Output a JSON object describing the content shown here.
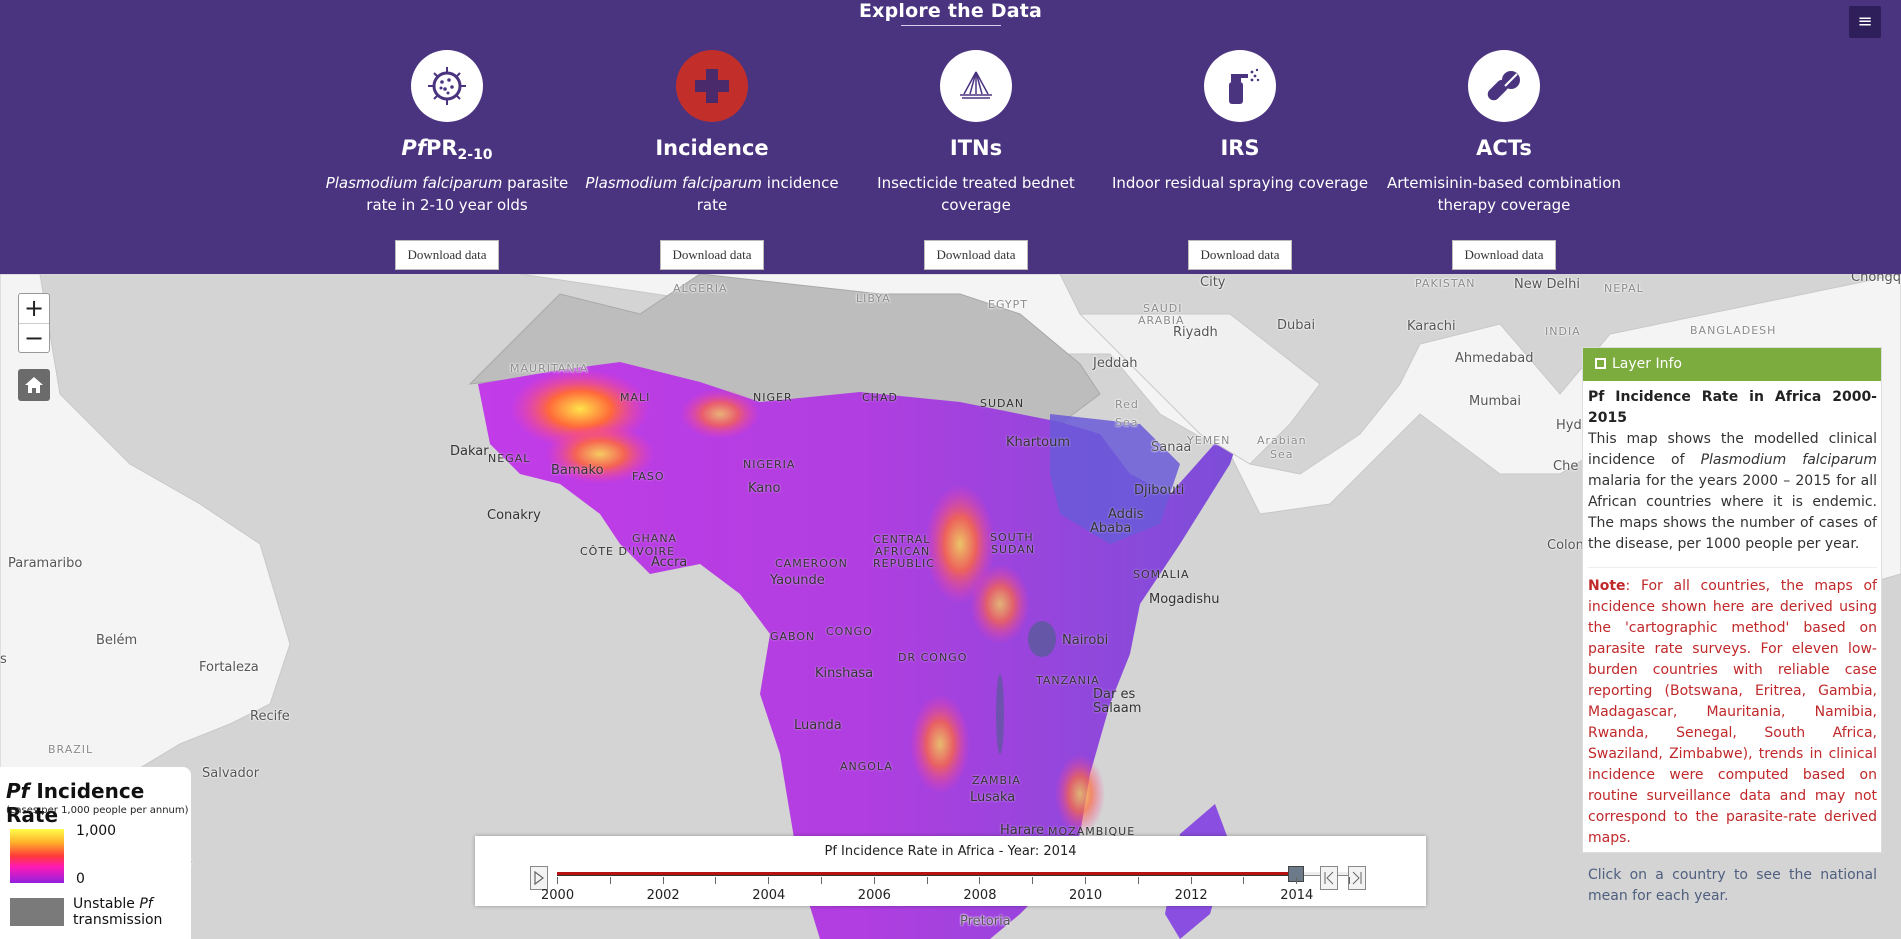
{
  "header": {
    "title": "Explore the Data",
    "menu_icon": "≡",
    "cards": [
      {
        "title_it": "Pf",
        "title": "PR",
        "title_sub": "2-10",
        "desc_it": "Plasmodium falciparum",
        "desc": " parasite rate in 2-10 year olds",
        "button": "Download data",
        "icon": "parasite-icon"
      },
      {
        "title_it": "",
        "title": "Incidence",
        "title_sub": "",
        "desc_it": "Plasmodium falciparum",
        "desc": " incidence rate",
        "button": "Download data",
        "icon": "medical-cross-icon"
      },
      {
        "title_it": "",
        "title": "ITNs",
        "title_sub": "",
        "desc_it": "",
        "desc": "Insecticide treated bednet coverage",
        "button": "Download data",
        "icon": "bednet-icon"
      },
      {
        "title_it": "",
        "title": "IRS",
        "title_sub": "",
        "desc_it": "",
        "desc": "Indoor residual spraying coverage",
        "button": "Download data",
        "icon": "spray-bottle-icon"
      },
      {
        "title_it": "",
        "title": "ACTs",
        "title_sub": "",
        "desc_it": "",
        "desc": "Artemisinin-based combination therapy coverage",
        "button": "Download data",
        "icon": "pills-icon"
      }
    ]
  },
  "map": {
    "zoom_in": "+",
    "zoom_out": "−",
    "places": [
      {
        "id": "algeria",
        "text": "ALGERIA"
      },
      {
        "id": "libya",
        "text": "LIBYA"
      },
      {
        "id": "egypt",
        "text": "EGYPT"
      },
      {
        "id": "city",
        "text": "City"
      },
      {
        "id": "saudi",
        "text": "SAUDI"
      },
      {
        "id": "arabia",
        "text": "ARABIA"
      },
      {
        "id": "riyadh",
        "text": "Riyadh"
      },
      {
        "id": "dubai",
        "text": "Dubai"
      },
      {
        "id": "pakistan",
        "text": "PAKISTAN"
      },
      {
        "id": "newdelhi",
        "text": "New Delhi"
      },
      {
        "id": "nepal",
        "text": "NEPAL"
      },
      {
        "id": "chongqing",
        "text": "Chongqir"
      },
      {
        "id": "karachi",
        "text": "Karachi"
      },
      {
        "id": "india",
        "text": "INDIA"
      },
      {
        "id": "bangladesh",
        "text": "BANGLADESH"
      },
      {
        "id": "ahmedabad",
        "text": "Ahmedabad"
      },
      {
        "id": "jeddah",
        "text": "Jeddah"
      },
      {
        "id": "mauritania",
        "text": "MAURITANIA"
      },
      {
        "id": "mumbai",
        "text": "Mumbai"
      },
      {
        "id": "hyderabad",
        "text": "Hyderaba"
      },
      {
        "id": "dakar",
        "text": "Dakar"
      },
      {
        "id": "bamako",
        "text": "Bamako"
      },
      {
        "id": "khartoum",
        "text": "Khartoum"
      },
      {
        "id": "sanaa",
        "text": "Sanaa"
      },
      {
        "id": "yemen",
        "text": "YEMEN"
      },
      {
        "id": "arabiansea",
        "text": "Arabian"
      },
      {
        "id": "sea",
        "text": "Sea"
      },
      {
        "id": "kano",
        "text": "Kano"
      },
      {
        "id": "djibouti",
        "text": "Djibouti"
      },
      {
        "id": "conakry",
        "text": "Conakry"
      },
      {
        "id": "addis",
        "text": "Addis"
      },
      {
        "id": "ababa",
        "text": "Ababa"
      },
      {
        "id": "southsudan",
        "text": "SOUTH"
      },
      {
        "id": "sudan2",
        "text": "SUDAN"
      },
      {
        "id": "car",
        "text": "CENTRAL"
      },
      {
        "id": "car2",
        "text": "AFRICAN"
      },
      {
        "id": "car3",
        "text": "REPUBLIC"
      },
      {
        "id": "cameroon",
        "text": "CAMEROON"
      },
      {
        "id": "paramaribo",
        "text": "Paramaribo"
      },
      {
        "id": "accra",
        "text": "Accra"
      },
      {
        "id": "colombo",
        "text": "Colon"
      },
      {
        "id": "somalia",
        "text": "SOMALIA"
      },
      {
        "id": "yaounde",
        "text": "Yaounde"
      },
      {
        "id": "mogadishu",
        "text": "Mogadishu"
      },
      {
        "id": "belem",
        "text": "Belém"
      },
      {
        "id": "gabon",
        "text": "GABON"
      },
      {
        "id": "congo",
        "text": "CONGO"
      },
      {
        "id": "nairobi",
        "text": "Nairobi"
      },
      {
        "id": "fortaleza",
        "text": "Fortaleza"
      },
      {
        "id": "drcongo",
        "text": "DR CONGO"
      },
      {
        "id": "kinshasa",
        "text": "Kinshasa"
      },
      {
        "id": "tanzania",
        "text": "TANZANIA"
      },
      {
        "id": "dar",
        "text": "Dar es"
      },
      {
        "id": "salaam",
        "text": "Salaam"
      },
      {
        "id": "recife",
        "text": "Recife"
      },
      {
        "id": "luanda",
        "text": "Luanda"
      },
      {
        "id": "brazil",
        "text": "BRAZIL"
      },
      {
        "id": "angola",
        "text": "ANGOLA"
      },
      {
        "id": "salvador",
        "text": "Salvador"
      },
      {
        "id": "zambia",
        "text": "ZAMBIA"
      },
      {
        "id": "lusaka",
        "text": "Lusaka"
      },
      {
        "id": "harare",
        "text": "Harare"
      },
      {
        "id": "mozambique",
        "text": "MOZAMBIQUE"
      },
      {
        "id": "pretoria",
        "text": "Pretoria"
      },
      {
        "id": "s",
        "text": "s"
      },
      {
        "id": "e",
        "text": "e"
      },
      {
        "id": "che",
        "text": "Che"
      },
      {
        "id": "mali",
        "text": "MALI"
      },
      {
        "id": "niger",
        "text": "NIGER"
      },
      {
        "id": "chad",
        "text": "CHAD"
      },
      {
        "id": "sudan",
        "text": "SUDAN"
      },
      {
        "id": "nigeria",
        "text": "NIGERIA"
      },
      {
        "id": "ghana",
        "text": "GHANA"
      },
      {
        "id": "cotedivoire",
        "text": "CÔTE D'IVOIRE"
      },
      {
        "id": "burkina",
        "text": "FASO"
      },
      {
        "id": "red",
        "text": "Red"
      },
      {
        "id": "sea2",
        "text": "Sea"
      },
      {
        "id": "senegal",
        "text": "NEGAL"
      }
    ]
  },
  "legend": {
    "title_it": "Pf",
    "title": " Incidence Rate",
    "subtitle": "(cases per 1,000 people per annum)",
    "high": "1,000",
    "low": "0",
    "unstable_line1": "Unstable ",
    "unstable_it": "Pf",
    "unstable_line2": "transmission",
    "colors": [
      "#ffff4a",
      "#ffb02a",
      "#ff3a3a",
      "#ff1ab4",
      "#9020e0"
    ]
  },
  "timeline": {
    "title": "Pf Incidence Rate in Africa - Year: 2014",
    "years": [
      "2000",
      "2002",
      "2004",
      "2006",
      "2008",
      "2010",
      "2012",
      "2014"
    ],
    "start_year": 2000,
    "end_year": 2015,
    "current_year": 2014
  },
  "layer_info": {
    "header": "Layer Info",
    "title": "Pf Incidence Rate in Africa 2000-2015",
    "p1_a": "This map shows the modelled clinical incidence of ",
    "p1_it": "Plasmodium falciparum",
    "p1_b": " malaria for the years 2000 – 2015 for all African countries where it is endemic. The maps shows the number of cases of the disease, per 1000 people per year.",
    "note_label": "Note",
    "note_text": ": For all countries, the maps of incidence shown here are derived using the 'cartographic method' based on parasite rate surveys. For eleven low-burden countries with reliable case reporting (Botswana, Eritrea, Gambia, Madagascar, Mauritania, Namibia, Rwanda, Senegal, South Africa, Swaziland, Zimbabwe), trends in clinical incidence were computed based on routine surveillance data and may not correspond to the parasite-rate derived maps.",
    "click": "Click on a country to see the national mean for each year."
  },
  "colors": {
    "header_bg": "#4a3480",
    "active_icon": "#c22f2b",
    "layer_info_header": "#7cac3e",
    "note_text": "#c0282a"
  }
}
